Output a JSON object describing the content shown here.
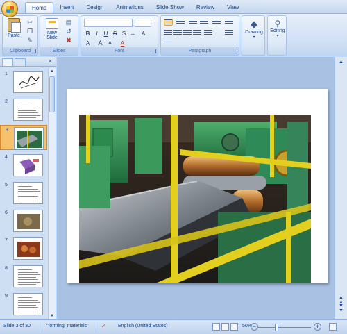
{
  "tabs": [
    "Home",
    "Insert",
    "Design",
    "Animations",
    "Slide Show",
    "Review",
    "View"
  ],
  "ribbon": {
    "clipboard": {
      "label": "Clipboard",
      "paste": "Paste"
    },
    "slides": {
      "label": "Slides",
      "new_slide_1": "New",
      "new_slide_2": "Slide"
    },
    "font": {
      "label": "Font",
      "font_name": "",
      "font_size": ""
    },
    "paragraph": {
      "label": "Paragraph"
    },
    "drawing": {
      "label": "Drawing"
    },
    "editing": {
      "label": "Editing"
    }
  },
  "thumbnails": [
    {
      "num": "1",
      "kind": "signature"
    },
    {
      "num": "2",
      "kind": "text"
    },
    {
      "num": "3",
      "kind": "photo",
      "active": true
    },
    {
      "num": "4",
      "kind": "diagram"
    },
    {
      "num": "5",
      "kind": "text"
    },
    {
      "num": "6",
      "kind": "photo2"
    },
    {
      "num": "7",
      "kind": "photo3"
    },
    {
      "num": "8",
      "kind": "text"
    },
    {
      "num": "9",
      "kind": "text"
    }
  ],
  "status": {
    "slide_info": "Slide 3 of 30",
    "theme": "\"forming_materials\"",
    "language": "English (United States)",
    "zoom": "50%"
  },
  "colors": {
    "accent": "#15428b",
    "active_thumb": "#f6c16a",
    "workspace": "#a9c2e4"
  }
}
